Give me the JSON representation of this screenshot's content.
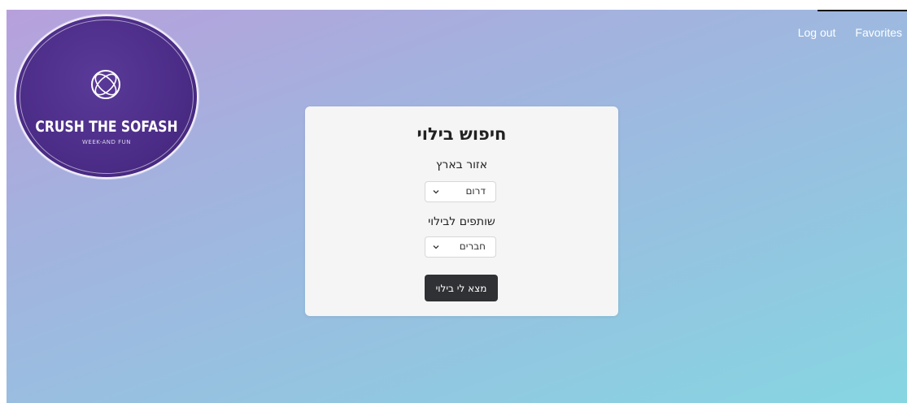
{
  "logo": {
    "title": "CRUSH THE SOFASH",
    "subtitle": "WEEK-AND FUN",
    "icon": "interlocking-rings-icon",
    "bg_color": "#4b2c87"
  },
  "nav": {
    "logout_label": "Log out",
    "favorites_label": "Favorites"
  },
  "search_card": {
    "title": "חיפוש בילוי",
    "region": {
      "label": "אזור בארץ",
      "selected": "דרום"
    },
    "companions": {
      "label": "שותפים לבילוי",
      "selected": "חברים"
    },
    "submit_label": "מצא לי בילוי",
    "button_color": "#2f3134"
  }
}
